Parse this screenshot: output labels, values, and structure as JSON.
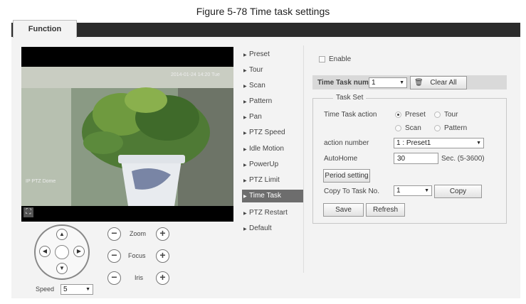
{
  "caption": "Figure 5-78 Time task settings",
  "tab": {
    "label": "Function"
  },
  "video": {
    "osd_time": "2014-01-24 14:20 Tue",
    "osd_camera": "IP PTZ Dome"
  },
  "ptz": {
    "zoom_label": "Zoom",
    "focus_label": "Focus",
    "iris_label": "Iris",
    "minus_glyph": "−",
    "plus_glyph": "+",
    "speed_label": "Speed",
    "speed_value": "5"
  },
  "menu": {
    "items": [
      {
        "label": "Preset"
      },
      {
        "label": "Tour"
      },
      {
        "label": "Scan"
      },
      {
        "label": "Pattern"
      },
      {
        "label": "Pan"
      },
      {
        "label": "PTZ Speed"
      },
      {
        "label": "Idle Motion"
      },
      {
        "label": "PowerUp"
      },
      {
        "label": "PTZ Limit"
      },
      {
        "label": "Time Task"
      },
      {
        "label": "PTZ Restart"
      },
      {
        "label": "Default"
      }
    ],
    "active": "Time Task"
  },
  "form": {
    "enable_label": "Enable",
    "time_task_num_label": "Time Task num",
    "time_task_num_value": "1",
    "clear_all_label": "Clear All",
    "task_set_legend": "Task Set",
    "time_task_action_label": "Time Task action",
    "actions": [
      {
        "label": "Preset",
        "selected": true
      },
      {
        "label": "Tour",
        "selected": false
      },
      {
        "label": "Scan",
        "selected": false
      },
      {
        "label": "Pattern",
        "selected": false
      }
    ],
    "action_number_label": "action number",
    "action_number_value": "1 : Preset1",
    "autohome_label": "AutoHome",
    "autohome_value": "30",
    "autohome_range": "Sec. (5-3600)",
    "period_setting_label": "Period setting",
    "copy_to_label": "Copy To Task No.",
    "copy_to_value": "1",
    "copy_label": "Copy",
    "save_label": "Save",
    "refresh_label": "Refresh"
  },
  "colors": {
    "tab_bar": "#2b2b2b",
    "panel_bg": "#f3f3f3",
    "active_menu": "#6d6d6d"
  }
}
